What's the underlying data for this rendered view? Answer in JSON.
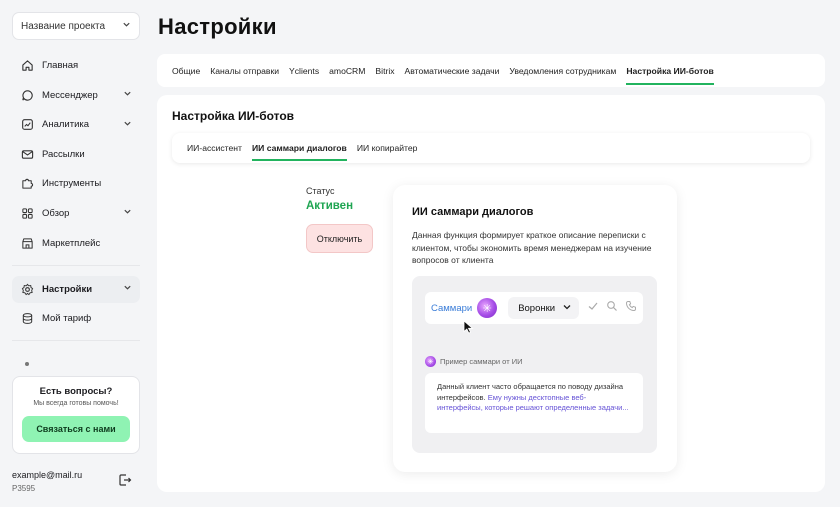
{
  "sidebar": {
    "project_select": "Название проекта",
    "items": [
      {
        "label": "Главная",
        "icon": "home-icon",
        "chevron": false
      },
      {
        "label": "Мессенджер",
        "icon": "chat-icon",
        "chevron": true
      },
      {
        "label": "Аналитика",
        "icon": "chart-icon",
        "chevron": true
      },
      {
        "label": "Рассылки",
        "icon": "mail-icon",
        "chevron": false
      },
      {
        "label": "Инструменты",
        "icon": "puzzle-icon",
        "chevron": false
      },
      {
        "label": "Обзор",
        "icon": "grid-icon",
        "chevron": true
      },
      {
        "label": "Маркетплейс",
        "icon": "store-icon",
        "chevron": false
      }
    ],
    "settings_label": "Настройки",
    "tariff_label": "Мой тариф",
    "help": {
      "title": "Есть вопросы?",
      "subtitle": "Мы всегда готовы помочь!",
      "button": "Связаться с нами"
    },
    "user": {
      "email": "example@mail.ru",
      "id": "P3595"
    }
  },
  "page": {
    "title": "Настройки"
  },
  "tabs": [
    {
      "label": "Общие",
      "active": false
    },
    {
      "label": "Каналы отправки",
      "active": false
    },
    {
      "label": "Yclients",
      "active": false
    },
    {
      "label": "amoCRM",
      "active": false
    },
    {
      "label": "Bitrix",
      "active": false
    },
    {
      "label": "Автоматические задачи",
      "active": false
    },
    {
      "label": "Уведомления сотрудникам",
      "active": false
    },
    {
      "label": "Настройка ИИ-ботов",
      "active": true
    }
  ],
  "panel": {
    "title": "Настройка ИИ-ботов",
    "subtabs": [
      {
        "label": "ИИ-ассистент",
        "active": false
      },
      {
        "label": "ИИ саммари диалогов",
        "active": true
      },
      {
        "label": "ИИ копирайтер",
        "active": false
      }
    ],
    "status_label": "Статус",
    "status_value": "Активен",
    "disable_button": "Отключить"
  },
  "feature": {
    "title": "ИИ саммари диалогов",
    "description": "Данная функция формирует краткое описание переписки с клиентом, чтобы экономить время менеджерам на изучение вопросов от клиента",
    "demo": {
      "summary_label": "Саммари",
      "funnel_label": "Воронки",
      "example_label": "Пример саммари от ИИ",
      "message_plain": "Данный клиент часто обращается по поводу дизайна интерфейсов. ",
      "message_highlight": "Ему нужны десктопные веб-интерфейсы, которые решают определенные задачи..."
    }
  },
  "colors": {
    "accent_green": "#22b35e",
    "status_green": "#1fa552",
    "help_button": "#8ff3b3",
    "disable_bg": "#fde2e2",
    "link_blue": "#3b7dd8",
    "highlight_purple": "#6552d6"
  }
}
